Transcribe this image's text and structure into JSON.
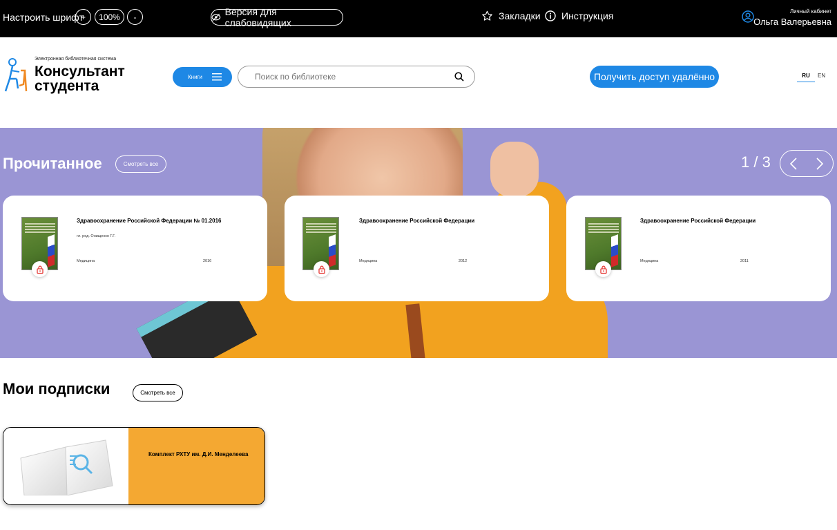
{
  "topbar": {
    "font_label": "Настроить шрифт",
    "plus": "+",
    "zoom": "100%",
    "minus": "-",
    "vision_version": "Версия для слабовидящих",
    "bookmarks": "Закладки",
    "instructions": "Инструкция",
    "cabinet_label": "Личный кабинет",
    "user_name": "Ольга Валерьевна"
  },
  "header": {
    "logo_subtitle": "Электронная библиотечная система",
    "logo_title": "Консультант студента",
    "books_button": "Книги",
    "search_placeholder": "Поиск по библиотеке",
    "access_button": "Получить доступ удалённо",
    "lang_ru": "RU",
    "lang_en": "EN"
  },
  "read": {
    "title": "Прочитанное",
    "see_all": "Смотреть все",
    "pager": "1 / 3",
    "cards": [
      {
        "title": "Здравоохранение Российской Федерации № 01.2016",
        "author": "гл. ред. Онищенко Г.Г.",
        "category": "Медицина",
        "year": "2016"
      },
      {
        "title": "Здравоохранение Российской Федерации",
        "author": "",
        "category": "Медицина",
        "year": "2012"
      },
      {
        "title": "Здравоохранение Российской Федерации",
        "author": "",
        "category": "Медицина",
        "year": "2011"
      }
    ]
  },
  "subscriptions": {
    "title": "Мои подписки",
    "see_all": "Смотреть все",
    "items": [
      {
        "name": "Комплект РХТУ им. Д.И. Менделеева"
      }
    ]
  },
  "colors": {
    "accent": "#1e88e5",
    "hero_bg": "#9a95d4",
    "subscription_bg": "#f4a832",
    "topbar_bg": "#000000"
  }
}
